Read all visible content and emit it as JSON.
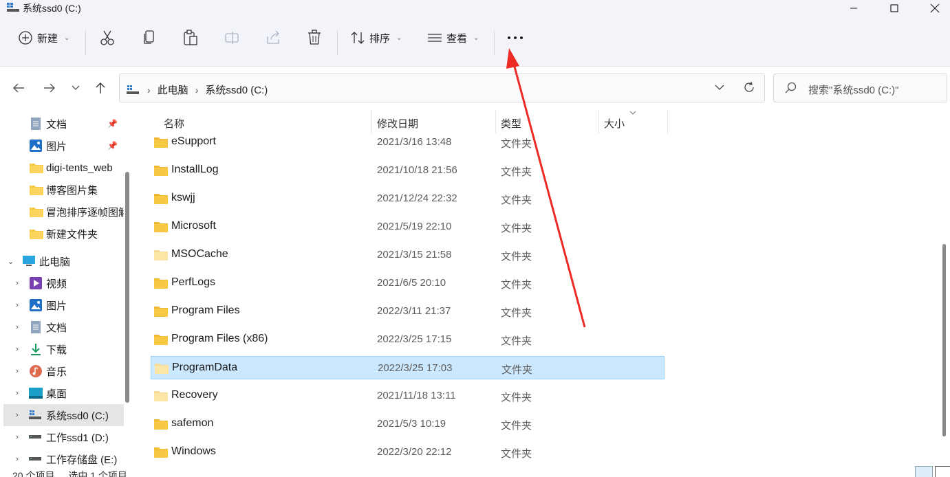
{
  "window": {
    "title": "系统ssd0 (C:)",
    "minimize_icon": "minimize-icon",
    "maximize_icon": "maximize-icon",
    "close_icon": "close-icon"
  },
  "toolbar": {
    "new_label": "新建",
    "sort_label": "排序",
    "view_label": "查看",
    "more_label": "···",
    "icons": [
      "cut-icon",
      "copy-icon",
      "paste-icon",
      "rename-icon",
      "share-icon",
      "delete-icon"
    ]
  },
  "address": {
    "crumbs": [
      "此电脑",
      "系统ssd0 (C:)"
    ]
  },
  "search": {
    "placeholder": "搜索\"系统ssd0 (C:)\""
  },
  "sidebar": {
    "quick_access": [
      {
        "label": "文档",
        "icon": "documents-icon",
        "pinned": true
      },
      {
        "label": "图片",
        "icon": "pictures-icon",
        "pinned": true
      },
      {
        "label": "digi-tents_web",
        "icon": "folder-icon"
      },
      {
        "label": "博客图片集",
        "icon": "folder-icon"
      },
      {
        "label": "冒泡排序逐帧图解",
        "icon": "folder-icon"
      },
      {
        "label": "新建文件夹",
        "icon": "folder-icon"
      }
    ],
    "this_pc": {
      "label": "此电脑",
      "icon": "computer-icon"
    },
    "pc_items": [
      {
        "label": "视频",
        "icon": "videos-icon"
      },
      {
        "label": "图片",
        "icon": "pictures-icon"
      },
      {
        "label": "文档",
        "icon": "documents-icon"
      },
      {
        "label": "下载",
        "icon": "downloads-icon"
      },
      {
        "label": "音乐",
        "icon": "music-icon"
      },
      {
        "label": "桌面",
        "icon": "desktop-icon"
      },
      {
        "label": "系统ssd0 (C:)",
        "icon": "drive-c-icon",
        "selected": true
      },
      {
        "label": "工作ssd1 (D:)",
        "icon": "drive-icon"
      },
      {
        "label": "工作存储盘 (E:)",
        "icon": "drive-icon"
      }
    ]
  },
  "columns": {
    "name": "名称",
    "date": "修改日期",
    "type": "类型",
    "size": "大小"
  },
  "files": [
    {
      "name": "eSupport",
      "date": "2021/3/16 13:48",
      "type": "文件夹"
    },
    {
      "name": "InstallLog",
      "date": "2021/10/18 21:56",
      "type": "文件夹"
    },
    {
      "name": "kswjj",
      "date": "2021/12/24 22:32",
      "type": "文件夹"
    },
    {
      "name": "Microsoft",
      "date": "2021/5/19 22:10",
      "type": "文件夹"
    },
    {
      "name": "MSOCache",
      "date": "2021/3/15 21:58",
      "type": "文件夹",
      "hidden": true
    },
    {
      "name": "PerfLogs",
      "date": "2021/6/5 20:10",
      "type": "文件夹"
    },
    {
      "name": "Program Files",
      "date": "2022/3/11 21:37",
      "type": "文件夹"
    },
    {
      "name": "Program Files (x86)",
      "date": "2022/3/25 17:15",
      "type": "文件夹"
    },
    {
      "name": "ProgramData",
      "date": "2022/3/25 17:03",
      "type": "文件夹",
      "hidden": true,
      "selected": true
    },
    {
      "name": "Recovery",
      "date": "2021/11/18 13:11",
      "type": "文件夹",
      "hidden": true
    },
    {
      "name": "safemon",
      "date": "2021/5/3 10:19",
      "type": "文件夹"
    },
    {
      "name": "Windows",
      "date": "2022/3/20 22:12",
      "type": "文件夹"
    }
  ],
  "status": {
    "count": "20 个项目",
    "selected": "选中 1 个项目"
  },
  "colors": {
    "folder": "#f7c843",
    "folder_hidden": "#fbe6a8",
    "selection": "#cce8ff",
    "annotation_arrow": "#ee2a24"
  }
}
